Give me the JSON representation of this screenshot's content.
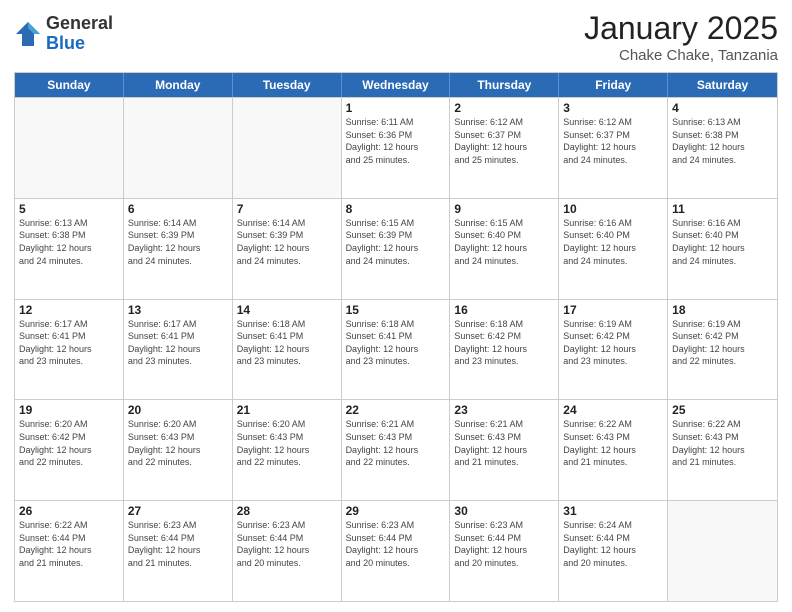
{
  "logo": {
    "general": "General",
    "blue": "Blue"
  },
  "title": "January 2025",
  "subtitle": "Chake Chake, Tanzania",
  "dayHeaders": [
    "Sunday",
    "Monday",
    "Tuesday",
    "Wednesday",
    "Thursday",
    "Friday",
    "Saturday"
  ],
  "weeks": [
    [
      {
        "day": "",
        "info": "",
        "empty": true
      },
      {
        "day": "",
        "info": "",
        "empty": true
      },
      {
        "day": "",
        "info": "",
        "empty": true
      },
      {
        "day": "1",
        "info": "Sunrise: 6:11 AM\nSunset: 6:36 PM\nDaylight: 12 hours\nand 25 minutes."
      },
      {
        "day": "2",
        "info": "Sunrise: 6:12 AM\nSunset: 6:37 PM\nDaylight: 12 hours\nand 25 minutes."
      },
      {
        "day": "3",
        "info": "Sunrise: 6:12 AM\nSunset: 6:37 PM\nDaylight: 12 hours\nand 24 minutes."
      },
      {
        "day": "4",
        "info": "Sunrise: 6:13 AM\nSunset: 6:38 PM\nDaylight: 12 hours\nand 24 minutes."
      }
    ],
    [
      {
        "day": "5",
        "info": "Sunrise: 6:13 AM\nSunset: 6:38 PM\nDaylight: 12 hours\nand 24 minutes."
      },
      {
        "day": "6",
        "info": "Sunrise: 6:14 AM\nSunset: 6:39 PM\nDaylight: 12 hours\nand 24 minutes."
      },
      {
        "day": "7",
        "info": "Sunrise: 6:14 AM\nSunset: 6:39 PM\nDaylight: 12 hours\nand 24 minutes."
      },
      {
        "day": "8",
        "info": "Sunrise: 6:15 AM\nSunset: 6:39 PM\nDaylight: 12 hours\nand 24 minutes."
      },
      {
        "day": "9",
        "info": "Sunrise: 6:15 AM\nSunset: 6:40 PM\nDaylight: 12 hours\nand 24 minutes."
      },
      {
        "day": "10",
        "info": "Sunrise: 6:16 AM\nSunset: 6:40 PM\nDaylight: 12 hours\nand 24 minutes."
      },
      {
        "day": "11",
        "info": "Sunrise: 6:16 AM\nSunset: 6:40 PM\nDaylight: 12 hours\nand 24 minutes."
      }
    ],
    [
      {
        "day": "12",
        "info": "Sunrise: 6:17 AM\nSunset: 6:41 PM\nDaylight: 12 hours\nand 23 minutes."
      },
      {
        "day": "13",
        "info": "Sunrise: 6:17 AM\nSunset: 6:41 PM\nDaylight: 12 hours\nand 23 minutes."
      },
      {
        "day": "14",
        "info": "Sunrise: 6:18 AM\nSunset: 6:41 PM\nDaylight: 12 hours\nand 23 minutes."
      },
      {
        "day": "15",
        "info": "Sunrise: 6:18 AM\nSunset: 6:41 PM\nDaylight: 12 hours\nand 23 minutes."
      },
      {
        "day": "16",
        "info": "Sunrise: 6:18 AM\nSunset: 6:42 PM\nDaylight: 12 hours\nand 23 minutes."
      },
      {
        "day": "17",
        "info": "Sunrise: 6:19 AM\nSunset: 6:42 PM\nDaylight: 12 hours\nand 23 minutes."
      },
      {
        "day": "18",
        "info": "Sunrise: 6:19 AM\nSunset: 6:42 PM\nDaylight: 12 hours\nand 22 minutes."
      }
    ],
    [
      {
        "day": "19",
        "info": "Sunrise: 6:20 AM\nSunset: 6:42 PM\nDaylight: 12 hours\nand 22 minutes."
      },
      {
        "day": "20",
        "info": "Sunrise: 6:20 AM\nSunset: 6:43 PM\nDaylight: 12 hours\nand 22 minutes."
      },
      {
        "day": "21",
        "info": "Sunrise: 6:20 AM\nSunset: 6:43 PM\nDaylight: 12 hours\nand 22 minutes."
      },
      {
        "day": "22",
        "info": "Sunrise: 6:21 AM\nSunset: 6:43 PM\nDaylight: 12 hours\nand 22 minutes."
      },
      {
        "day": "23",
        "info": "Sunrise: 6:21 AM\nSunset: 6:43 PM\nDaylight: 12 hours\nand 21 minutes."
      },
      {
        "day": "24",
        "info": "Sunrise: 6:22 AM\nSunset: 6:43 PM\nDaylight: 12 hours\nand 21 minutes."
      },
      {
        "day": "25",
        "info": "Sunrise: 6:22 AM\nSunset: 6:43 PM\nDaylight: 12 hours\nand 21 minutes."
      }
    ],
    [
      {
        "day": "26",
        "info": "Sunrise: 6:22 AM\nSunset: 6:44 PM\nDaylight: 12 hours\nand 21 minutes."
      },
      {
        "day": "27",
        "info": "Sunrise: 6:23 AM\nSunset: 6:44 PM\nDaylight: 12 hours\nand 21 minutes."
      },
      {
        "day": "28",
        "info": "Sunrise: 6:23 AM\nSunset: 6:44 PM\nDaylight: 12 hours\nand 20 minutes."
      },
      {
        "day": "29",
        "info": "Sunrise: 6:23 AM\nSunset: 6:44 PM\nDaylight: 12 hours\nand 20 minutes."
      },
      {
        "day": "30",
        "info": "Sunrise: 6:23 AM\nSunset: 6:44 PM\nDaylight: 12 hours\nand 20 minutes."
      },
      {
        "day": "31",
        "info": "Sunrise: 6:24 AM\nSunset: 6:44 PM\nDaylight: 12 hours\nand 20 minutes."
      },
      {
        "day": "",
        "info": "",
        "empty": true
      }
    ]
  ]
}
